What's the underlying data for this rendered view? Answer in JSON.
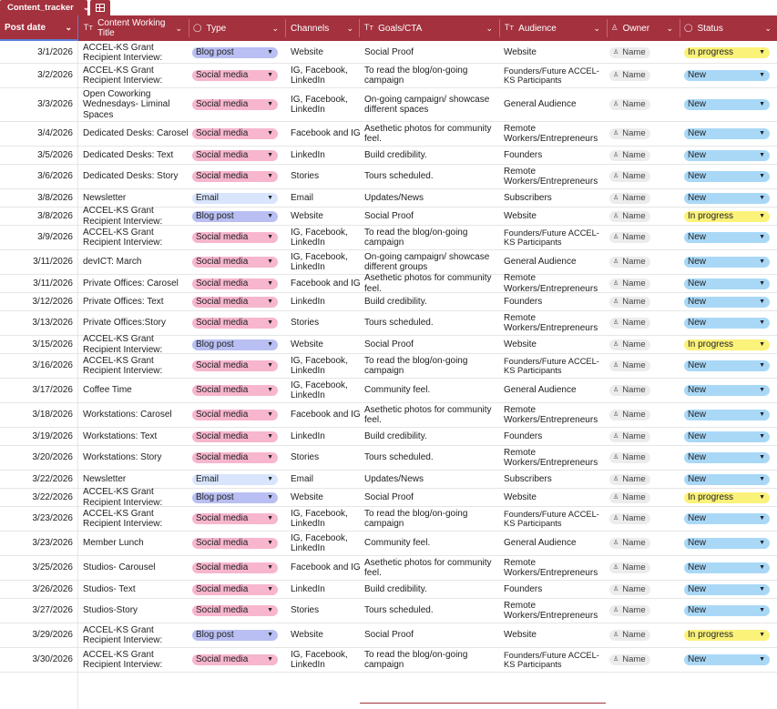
{
  "tabs": {
    "sheet_name": "Content_tracker"
  },
  "columns": {
    "post_date": "Post date",
    "title": "Content Working Title",
    "type": "Type",
    "channels": "Channels",
    "goals": "Goals/CTA",
    "audience": "Audience",
    "owner": "Owner",
    "status": "Status"
  },
  "colors": {
    "header": "#a3313e",
    "blog_post": "#b9bff2",
    "social_media": "#f7b6cd",
    "email": "#d8e5fc",
    "new": "#a9d8f7",
    "in_progress": "#fbf27a"
  },
  "rows": [
    {
      "date": "3/1/2026",
      "title": "ACCEL-KS Grant Recipient Interview:",
      "type": "Blog post",
      "channels": "Website",
      "goals": "Social Proof",
      "audience": "Website",
      "owner": "Name",
      "status": "In progress"
    },
    {
      "date": "3/2/2026",
      "title": "ACCEL-KS Grant Recipient Interview:",
      "type": "Social media",
      "channels": "IG, Facebook, LinkedIn",
      "goals": "To read the blog/on-going campaign",
      "audience": "Founders/Future ACCEL-KS Participants",
      "owner": "Name",
      "status": "New"
    },
    {
      "date": "3/3/2026",
      "title": "Open Coworking Wednesdays- Liminal Spaces",
      "type": "Social media",
      "channels": "IG, Facebook, LinkedIn",
      "goals": "On-going campaign/ showcase different spaces",
      "audience": "General Audience",
      "owner": "Name",
      "status": "New"
    },
    {
      "date": "3/4/2026",
      "title": "Dedicated Desks: Carosel",
      "type": "Social media",
      "channels": "Facebook and IG",
      "goals": "Asethetic photos for community feel.",
      "audience": "Remote Workers/Entrepreneurs",
      "owner": "Name",
      "status": "New"
    },
    {
      "date": "3/5/2026",
      "title": "Dedicated Desks: Text",
      "type": "Social media",
      "channels": "LinkedIn",
      "goals": "Build credibility.",
      "audience": "Founders",
      "owner": "Name",
      "status": "New"
    },
    {
      "date": "3/6/2026",
      "title": "Dedicated Desks: Story",
      "type": "Social media",
      "channels": "Stories",
      "goals": "Tours scheduled.",
      "audience": "Remote Workers/Entrepreneurs",
      "owner": "Name",
      "status": "New"
    },
    {
      "date": "3/8/2026",
      "title": "Newsletter",
      "type": "Email",
      "channels": "Email",
      "goals": "Updates/News",
      "audience": "Subscribers",
      "owner": "Name",
      "status": "New"
    },
    {
      "date": "3/8/2026",
      "title": "ACCEL-KS Grant Recipient Interview:",
      "type": "Blog post",
      "channels": "Website",
      "goals": "Social Proof",
      "audience": "Website",
      "owner": "Name",
      "status": "In progress"
    },
    {
      "date": "3/9/2026",
      "title": "ACCEL-KS Grant Recipient Interview:",
      "type": "Social media",
      "channels": "IG, Facebook, LinkedIn",
      "goals": "To read the blog/on-going campaign",
      "audience": "Founders/Future ACCEL-KS Participants",
      "owner": "Name",
      "status": "New"
    },
    {
      "date": "3/11/2026",
      "title": "devICT: March",
      "type": "Social media",
      "channels": "IG, Facebook, LinkedIn",
      "goals": "On-going campaign/ showcase different groups",
      "audience": "General Audience",
      "owner": "Name",
      "status": "New"
    },
    {
      "date": "3/11/2026",
      "title": "Private Offices: Carosel",
      "type": "Social media",
      "channels": "Facebook and IG",
      "goals": "Asethetic photos for community feel.",
      "audience": "Remote Workers/Entrepreneurs",
      "owner": "Name",
      "status": "New"
    },
    {
      "date": "3/12/2026",
      "title": "Private Offices: Text",
      "type": "Social media",
      "channels": "LinkedIn",
      "goals": "Build credibility.",
      "audience": "Founders",
      "owner": "Name",
      "status": "New"
    },
    {
      "date": "3/13/2026",
      "title": "Private Offices:Story",
      "type": "Social media",
      "channels": "Stories",
      "goals": "Tours scheduled.",
      "audience": "Remote Workers/Entrepreneurs",
      "owner": "Name",
      "status": "New"
    },
    {
      "date": "3/15/2026",
      "title": "ACCEL-KS Grant Recipient Interview:",
      "type": "Blog post",
      "channels": "Website",
      "goals": "Social Proof",
      "audience": "Website",
      "owner": "Name",
      "status": "In progress"
    },
    {
      "date": "3/16/2026",
      "title": "ACCEL-KS Grant Recipient Interview:",
      "type": "Social media",
      "channels": "IG, Facebook, LinkedIn",
      "goals": "To read the blog/on-going campaign",
      "audience": "Founders/Future ACCEL-KS Participants",
      "owner": "Name",
      "status": "New"
    },
    {
      "date": "3/17/2026",
      "title": "Coffee Time",
      "type": "Social media",
      "channels": "IG, Facebook, LinkedIn",
      "goals": "Community feel.",
      "audience": "General Audience",
      "owner": "Name",
      "status": "New"
    },
    {
      "date": "3/18/2026",
      "title": "Workstations: Carosel",
      "type": "Social media",
      "channels": "Facebook and IG",
      "goals": "Asethetic photos for community feel.",
      "audience": "Remote Workers/Entrepreneurs",
      "owner": "Name",
      "status": "New"
    },
    {
      "date": "3/19/2026",
      "title": "Workstations: Text",
      "type": "Social media",
      "channels": "LinkedIn",
      "goals": "Build credibility.",
      "audience": "Founders",
      "owner": "Name",
      "status": "New"
    },
    {
      "date": "3/20/2026",
      "title": "Workstations: Story",
      "type": "Social media",
      "channels": "Stories",
      "goals": "Tours scheduled.",
      "audience": "Remote Workers/Entrepreneurs",
      "owner": "Name",
      "status": "New"
    },
    {
      "date": "3/22/2026",
      "title": "Newsletter",
      "type": "Email",
      "channels": "Email",
      "goals": "Updates/News",
      "audience": "Subscribers",
      "owner": "Name",
      "status": "New"
    },
    {
      "date": "3/22/2026",
      "title": "ACCEL-KS Grant Recipient Interview:",
      "type": "Blog post",
      "channels": "Website",
      "goals": "Social Proof",
      "audience": "Website",
      "owner": "Name",
      "status": "In progress"
    },
    {
      "date": "3/23/2026",
      "title": "ACCEL-KS Grant Recipient Interview:",
      "type": "Social media",
      "channels": "IG, Facebook, LinkedIn",
      "goals": "To read the blog/on-going campaign",
      "audience": "Founders/Future ACCEL-KS Participants",
      "owner": "Name",
      "status": "New"
    },
    {
      "date": "3/23/2026",
      "title": "Member Lunch",
      "type": "Social media",
      "channels": "IG, Facebook, LinkedIn",
      "goals": "Community feel.",
      "audience": "General Audience",
      "owner": "Name",
      "status": "New"
    },
    {
      "date": "3/25/2026",
      "title": "Studios- Carousel",
      "type": "Social media",
      "channels": "Facebook and IG",
      "goals": "Asethetic photos for community feel.",
      "audience": "Remote Workers/Entrepreneurs",
      "owner": "Name",
      "status": "New"
    },
    {
      "date": "3/26/2026",
      "title": "Studios- Text",
      "type": "Social media",
      "channels": "LinkedIn",
      "goals": "Build credibility.",
      "audience": "Founders",
      "owner": "Name",
      "status": "New"
    },
    {
      "date": "3/27/2026",
      "title": "Studios-Story",
      "type": "Social media",
      "channels": "Stories",
      "goals": "Tours scheduled.",
      "audience": "Remote Workers/Entrepreneurs",
      "owner": "Name",
      "status": "New"
    },
    {
      "date": "3/29/2026",
      "title": "ACCEL-KS Grant Recipient Interview:",
      "type": "Blog post",
      "channels": "Website",
      "goals": "Social Proof",
      "audience": "Website",
      "owner": "Name",
      "status": "In progress"
    },
    {
      "date": "3/30/2026",
      "title": "ACCEL-KS Grant Recipient Interview:",
      "type": "Social media",
      "channels": "IG, Facebook, LinkedIn",
      "goals": "To read the blog/on-going campaign",
      "audience": "Founders/Future ACCEL-KS Participants",
      "owner": "Name",
      "status": "New"
    }
  ]
}
